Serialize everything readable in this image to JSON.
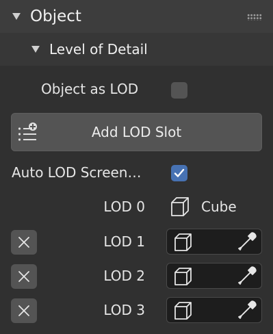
{
  "object_panel": {
    "title": "Object"
  },
  "lod_panel": {
    "title": "Level of Detail"
  },
  "object_as_lod": {
    "label": "Object as LOD",
    "checked": false
  },
  "add_lod_slot": {
    "label": "Add LOD Slot"
  },
  "auto_lod": {
    "label": "Auto LOD Screen…",
    "checked": true
  },
  "lods": [
    {
      "label": "LOD 0",
      "object": "Cube",
      "removable": false
    },
    {
      "label": "LOD 1",
      "object": "",
      "removable": true
    },
    {
      "label": "LOD 2",
      "object": "",
      "removable": true
    },
    {
      "label": "LOD 3",
      "object": "",
      "removable": true
    }
  ],
  "icons": {
    "collapse": "triangle-down-icon",
    "drag": "grip-dots-icon",
    "add_slot": "list-add-icon",
    "remove": "x-icon",
    "object": "cube-icon",
    "eyedropper": "eyedropper-icon",
    "check": "checkmark-icon"
  },
  "colors": {
    "background": "#303030",
    "header": "#3d3d3d",
    "subheader": "#373737",
    "button": "#545454",
    "field": "#1d1d1d",
    "checkbox_on": "#4772b3",
    "text": "#e6e6e6"
  }
}
